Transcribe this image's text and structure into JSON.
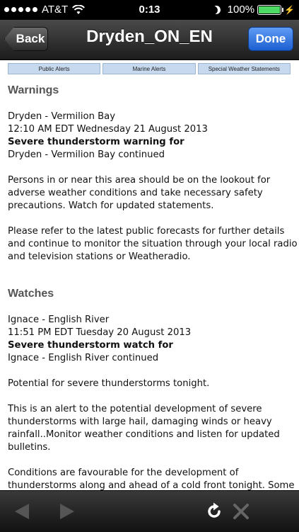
{
  "status_bar": {
    "carrier": "AT&T",
    "time": "0:13",
    "battery": "100%",
    "battery_level": 1.0,
    "icons": [
      "signal-dots",
      "wifi-icon",
      "moon-icon",
      "battery-icon",
      "charging-bolt-icon"
    ]
  },
  "nav": {
    "back_label": "Back",
    "title": "Dryden_ON_EN",
    "done_label": "Done"
  },
  "tabs": [
    "Public Alerts",
    "Marine Alerts",
    "Special Weather Statements"
  ],
  "warnings": {
    "heading": "Warnings",
    "location": "Dryden - Vermilion Bay",
    "datetime": "12:10 AM EDT Wednesday 21 August 2013",
    "title": "Severe thunderstorm warning for",
    "subtitle": "Dryden - Vermilion Bay continued",
    "para1_lines": [
      "Persons in or near this area should be on the lookout for",
      "adverse weather conditions and take necessary safety",
      "precautions. Watch for updated statements."
    ],
    "para2_lines": [
      "Please refer to the latest public forecasts for further details",
      "and continue to monitor the situation through your local radio",
      "and television stations or Weatheradio."
    ]
  },
  "watches": {
    "heading": "Watches",
    "location": "Ignace - English River",
    "datetime": "11:51 PM EDT Tuesday 20 August 2013",
    "title": "Severe thunderstorm watch for",
    "subtitle": "Ignace - English River continued",
    "para1_lines": [
      "Potential for severe thunderstorms tonight."
    ],
    "para2_lines": [
      "This is an alert to the potential development of severe",
      "thunderstorms with large hail, damaging winds or heavy",
      "rainfall..Monitor weather conditions and listen for updated",
      "bulletins."
    ],
    "para3_lines": [
      "Conditions are favourable for the development of",
      "thunderstorms along and ahead of a cold front tonight. Some"
    ]
  },
  "toolbar": {
    "icons": [
      "back-arrow-icon",
      "forward-arrow-icon",
      "refresh-icon",
      "stop-icon"
    ]
  },
  "colors": {
    "done_button": "#1c5fd0",
    "tab_background": "#c6d9ee",
    "heading_gray": "#555555"
  }
}
